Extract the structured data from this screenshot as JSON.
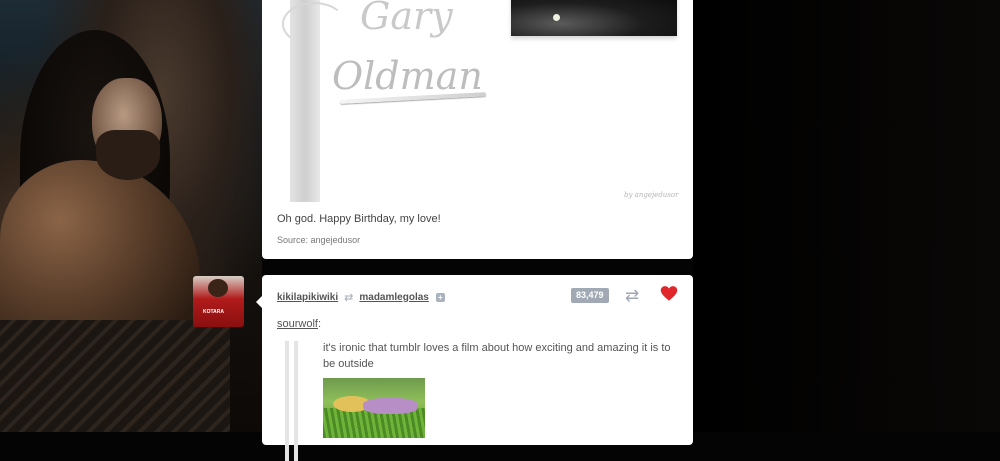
{
  "post1": {
    "image_text": {
      "first_name": "Gary",
      "last_name": "Oldman",
      "watermark": "by angejedusor"
    },
    "caption": "Oh god. Happy Birthday, my love!",
    "source_label": "Source:",
    "source_name": "angejedusor"
  },
  "post2": {
    "author": "kikilapikiwiki",
    "reblogged_from": "madamlegolas",
    "note_count": "83,479",
    "via_user": "sourwolf",
    "quote": "it's ironic that tumblr loves a film about how exciting and amazing it is to be outside",
    "avatar_shirt_text": "KOTARA"
  },
  "colors": {
    "like_heart": "#e0282c",
    "note_badge": "#a0a9b4",
    "icon_gray": "#9fa8b2"
  },
  "icons": {
    "reblog": "reblog-icon",
    "like": "heart-icon",
    "follow": "plus-icon"
  }
}
